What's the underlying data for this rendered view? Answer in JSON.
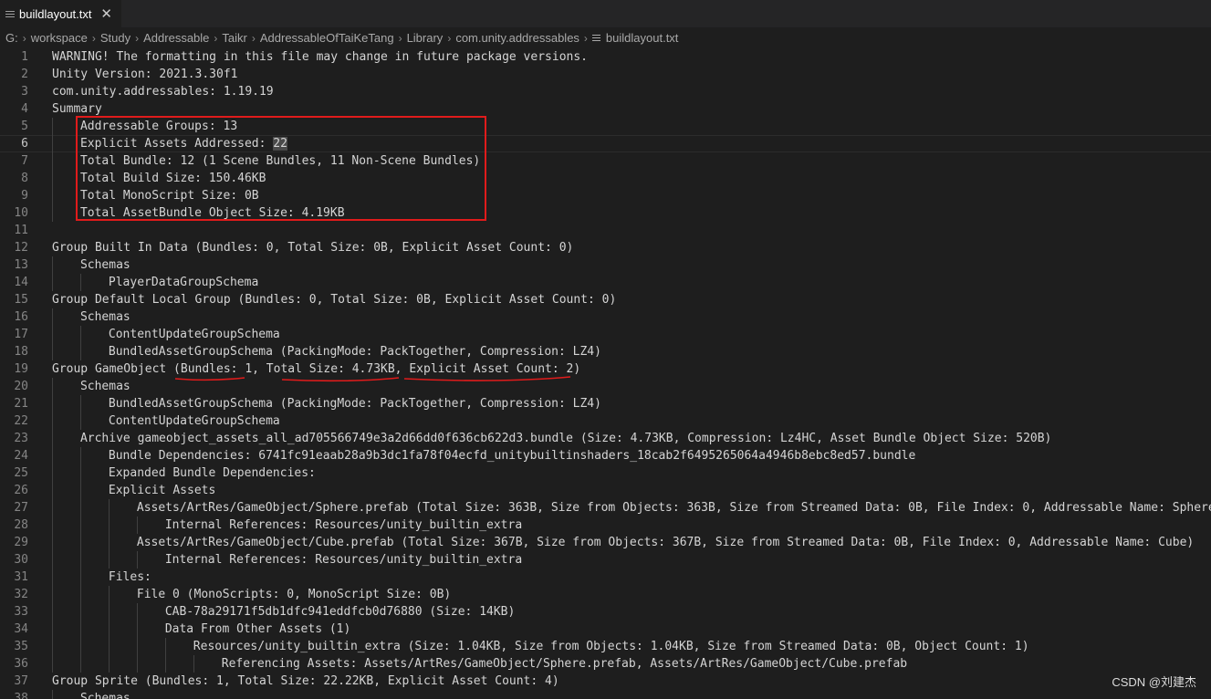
{
  "tab": {
    "title": "buildlayout.txt",
    "icon": "file-lines-icon",
    "close_glyph": "✕"
  },
  "breadcrumb": {
    "items": [
      "G:",
      "workspace",
      "Study",
      "Addressable",
      "Taikr",
      "AddressableOfTaiKeTang",
      "Library",
      "com.unity.addressables"
    ],
    "file": "buildlayout.txt",
    "separator": "›"
  },
  "editor": {
    "current_line": 6,
    "highlight": {
      "line": 6,
      "text": "22"
    },
    "lines": [
      {
        "n": "1",
        "indent": 0,
        "text": "WARNING! The formatting in this file may change in future package versions."
      },
      {
        "n": "2",
        "indent": 0,
        "text": "Unity Version: 2021.3.30f1"
      },
      {
        "n": "3",
        "indent": 0,
        "text": "com.unity.addressables: 1.19.19"
      },
      {
        "n": "4",
        "indent": 0,
        "text": "Summary"
      },
      {
        "n": "5",
        "indent": 1,
        "text": "Addressable Groups: 13"
      },
      {
        "n": "6",
        "indent": 1,
        "text": "Explicit Assets Addressed: 22"
      },
      {
        "n": "7",
        "indent": 1,
        "text": "Total Bundle: 12 (1 Scene Bundles, 11 Non-Scene Bundles)"
      },
      {
        "n": "8",
        "indent": 1,
        "text": "Total Build Size: 150.46KB"
      },
      {
        "n": "9",
        "indent": 1,
        "text": "Total MonoScript Size: 0B"
      },
      {
        "n": "10",
        "indent": 1,
        "text": "Total AssetBundle Object Size: 4.19KB"
      },
      {
        "n": "11",
        "indent": 0,
        "text": ""
      },
      {
        "n": "12",
        "indent": 0,
        "text": "Group Built In Data (Bundles: 0, Total Size: 0B, Explicit Asset Count: 0)"
      },
      {
        "n": "13",
        "indent": 1,
        "text": "Schemas"
      },
      {
        "n": "14",
        "indent": 2,
        "text": "PlayerDataGroupSchema"
      },
      {
        "n": "15",
        "indent": 0,
        "text": "Group Default Local Group (Bundles: 0, Total Size: 0B, Explicit Asset Count: 0)"
      },
      {
        "n": "16",
        "indent": 1,
        "text": "Schemas"
      },
      {
        "n": "17",
        "indent": 2,
        "text": "ContentUpdateGroupSchema"
      },
      {
        "n": "18",
        "indent": 2,
        "text": "BundledAssetGroupSchema (PackingMode: PackTogether, Compression: LZ4)"
      },
      {
        "n": "19",
        "indent": 0,
        "text": "Group GameObject (Bundles: 1, Total Size: 4.73KB, Explicit Asset Count: 2)"
      },
      {
        "n": "20",
        "indent": 1,
        "text": "Schemas"
      },
      {
        "n": "21",
        "indent": 2,
        "text": "BundledAssetGroupSchema (PackingMode: PackTogether, Compression: LZ4)"
      },
      {
        "n": "22",
        "indent": 2,
        "text": "ContentUpdateGroupSchema"
      },
      {
        "n": "23",
        "indent": 1,
        "text": "Archive gameobject_assets_all_ad705566749e3a2d66dd0f636cb622d3.bundle (Size: 4.73KB, Compression: Lz4HC, Asset Bundle Object Size: 520B)"
      },
      {
        "n": "24",
        "indent": 2,
        "text": "Bundle Dependencies: 6741fc91eaab28a9b3dc1fa78f04ecfd_unitybuiltinshaders_18cab2f6495265064a4946b8ebc8ed57.bundle"
      },
      {
        "n": "25",
        "indent": 2,
        "text": "Expanded Bundle Dependencies:"
      },
      {
        "n": "26",
        "indent": 2,
        "text": "Explicit Assets"
      },
      {
        "n": "27",
        "indent": 3,
        "text": "Assets/ArtRes/GameObject/Sphere.prefab (Total Size: 363B, Size from Objects: 363B, Size from Streamed Data: 0B, File Index: 0, Addressable Name: Sphere)"
      },
      {
        "n": "28",
        "indent": 4,
        "text": "Internal References: Resources/unity_builtin_extra"
      },
      {
        "n": "29",
        "indent": 3,
        "text": "Assets/ArtRes/GameObject/Cube.prefab (Total Size: 367B, Size from Objects: 367B, Size from Streamed Data: 0B, File Index: 0, Addressable Name: Cube)"
      },
      {
        "n": "30",
        "indent": 4,
        "text": "Internal References: Resources/unity_builtin_extra"
      },
      {
        "n": "31",
        "indent": 2,
        "text": "Files:"
      },
      {
        "n": "32",
        "indent": 3,
        "text": "File 0 (MonoScripts: 0, MonoScript Size: 0B)"
      },
      {
        "n": "33",
        "indent": 4,
        "text": "CAB-78a29171f5db1dfc941eddfcb0d76880 (Size: 14KB)"
      },
      {
        "n": "34",
        "indent": 4,
        "text": "Data From Other Assets (1)"
      },
      {
        "n": "35",
        "indent": 5,
        "text": "Resources/unity_builtin_extra (Size: 1.04KB, Size from Objects: 1.04KB, Size from Streamed Data: 0B, Object Count: 1)"
      },
      {
        "n": "36",
        "indent": 6,
        "text": "Referencing Assets: Assets/ArtRes/GameObject/Sphere.prefab, Assets/ArtRes/GameObject/Cube.prefab"
      },
      {
        "n": "37",
        "indent": 0,
        "text": "Group Sprite (Bundles: 1, Total Size: 22.22KB, Explicit Asset Count: 4)"
      },
      {
        "n": "38",
        "indent": 1,
        "text": "Schemas"
      }
    ]
  },
  "annotations": {
    "box_color": "#e01b1b",
    "underline_color": "#e01b1b"
  },
  "watermark": "CSDN @刘建杰"
}
